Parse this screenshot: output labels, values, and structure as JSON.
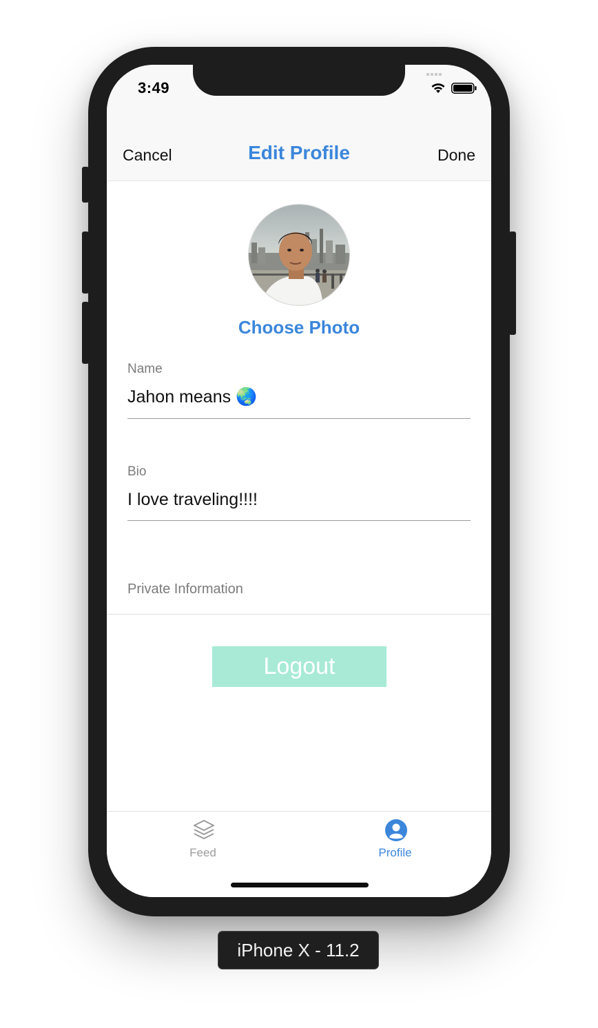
{
  "status_bar": {
    "time": "3:49"
  },
  "nav": {
    "cancel_label": "Cancel",
    "title": "Edit Profile",
    "done_label": "Done"
  },
  "profile": {
    "avatar_icon": "profile-photo",
    "choose_photo_label": "Choose Photo"
  },
  "form": {
    "name_label": "Name",
    "name_value": "Jahon means 🌏",
    "bio_label": "Bio",
    "bio_value": "I love traveling!!!!",
    "private_section_label": "Private Information"
  },
  "logout_label": "Logout",
  "tabbar": {
    "tabs": [
      {
        "label": "Feed",
        "icon": "layers-icon",
        "selected": false
      },
      {
        "label": "Profile",
        "icon": "person-circle-icon",
        "selected": true
      }
    ]
  },
  "device_label": "iPhone X - 11.2",
  "colors": {
    "accent": "#3b86db",
    "logout_bg": "#a8ead6",
    "inactive_tab": "#9b9b9b"
  }
}
